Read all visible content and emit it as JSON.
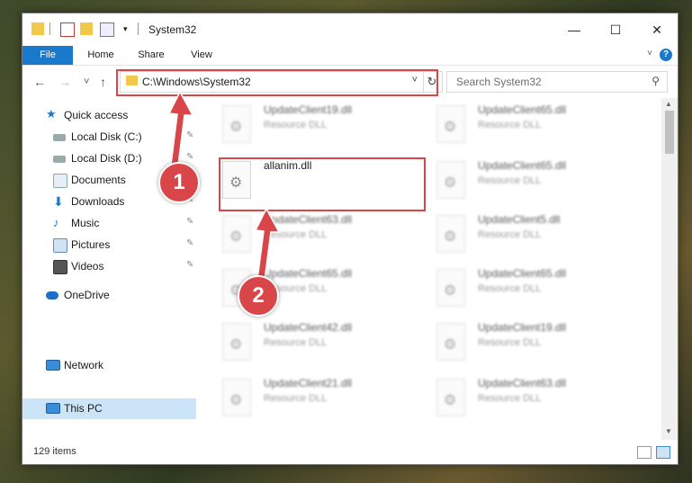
{
  "window": {
    "title": "System32",
    "minimize": "—",
    "maximize": "☐",
    "close": "✕"
  },
  "ribbon": {
    "tabs": [
      "File",
      "Home",
      "Share",
      "View"
    ],
    "help": "?"
  },
  "nav": {
    "back": "←",
    "forward": "→",
    "recent": "˅",
    "up": "↑",
    "address": "C:\\Windows\\System32",
    "refresh": "↻",
    "search_placeholder": "Search System32"
  },
  "sidebar": {
    "items": [
      {
        "label": "Quick access",
        "icon": "star-icon"
      },
      {
        "label": "Local Disk (C:)",
        "icon": "drive-icon"
      },
      {
        "label": "Local Disk (D:)",
        "icon": "drive-icon"
      },
      {
        "label": "Documents",
        "icon": "documents-icon"
      },
      {
        "label": "Downloads",
        "icon": "downloads-icon"
      },
      {
        "label": "Music",
        "icon": "music-icon"
      },
      {
        "label": "Pictures",
        "icon": "pictures-icon"
      },
      {
        "label": "Videos",
        "icon": "videos-icon"
      },
      {
        "label": "OneDrive",
        "icon": "cloud-icon"
      },
      {
        "label": "This PC",
        "icon": "computer-icon"
      },
      {
        "label": "Network",
        "icon": "network-icon"
      }
    ]
  },
  "files": {
    "col1": [
      {
        "name": "UpdateClient19.dll",
        "type": "Resource DLL"
      },
      {
        "name": "allanim.dll",
        "type": ""
      },
      {
        "name": "UpdateClient63.dll",
        "type": "Resource DLL"
      },
      {
        "name": "UpdateClient65.dll",
        "type": "Resource DLL"
      },
      {
        "name": "UpdateClient42.dll",
        "type": "Resource DLL"
      },
      {
        "name": "UpdateClient21.dll",
        "type": "Resource DLL"
      }
    ],
    "col2": [
      {
        "name": "UpdateClient65.dll",
        "type": "Resource DLL"
      },
      {
        "name": "UpdateClient65.dll",
        "type": "Resource DLL"
      },
      {
        "name": "UpdateClient5.dll",
        "type": "Resource DLL"
      },
      {
        "name": "UpdateClient65.dll",
        "type": "Resource DLL"
      },
      {
        "name": "UpdateClient19.dll",
        "type": "Resource DLL"
      },
      {
        "name": "UpdateClient63.dll",
        "type": "Resource DLL"
      }
    ]
  },
  "status": {
    "count": "129 items"
  },
  "callouts": [
    "1",
    "2"
  ],
  "colors": {
    "accent": "#1979ca",
    "highlight": "#d9464a",
    "selection": "#cce4f7"
  }
}
